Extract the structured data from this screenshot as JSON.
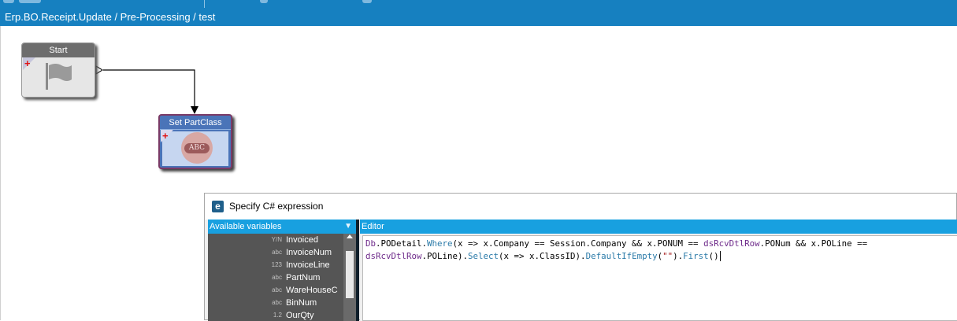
{
  "window": {
    "breadcrumb": "Erp.BO.Receipt.Update / Pre-Processing / test"
  },
  "canvas": {
    "nodes": [
      {
        "id": "start",
        "title": "Start",
        "icon": "flag-icon"
      },
      {
        "id": "set-partclass",
        "title": "Set PartClass",
        "icon": "abc-icon",
        "icon_text": "ABC"
      }
    ]
  },
  "dialog": {
    "title": "Specify C# expression",
    "icon": "expression-dialog-icon",
    "variables_header": "Available variables",
    "editor_header": "Editor",
    "variables": [
      {
        "type": "Y/N",
        "name": "Invoiced"
      },
      {
        "type": "abc",
        "name": "InvoiceNum"
      },
      {
        "type": "123",
        "name": "InvoiceLine"
      },
      {
        "type": "abc",
        "name": "PartNum"
      },
      {
        "type": "abc",
        "name": "WareHouseC"
      },
      {
        "type": "abc",
        "name": "BinNum"
      },
      {
        "type": "1.2",
        "name": "OurQty"
      }
    ],
    "expression": {
      "t1": "Db",
      "t2": ".PODetail.",
      "t3": "Where",
      "t4": "(x => x.Company == Session.Company && x.PONUM == ",
      "t5": "dsRcvDtlRow",
      "t6": ".PONum && x.POLine ==\n",
      "t7": "dsRcvDtlRow",
      "t8": ".POLine).",
      "t9": "Select",
      "t10": "(x => x.ClassID).",
      "t11": "DefaultIfEmpty",
      "t12": "(",
      "t13": "\"\"",
      "t14": ").",
      "t15": "First",
      "t16": "()"
    }
  },
  "colors": {
    "accent": "#1680c0",
    "panel_header": "#18a0e0",
    "start_node": "#6d6d6d",
    "action_node": "#4a74b8"
  }
}
